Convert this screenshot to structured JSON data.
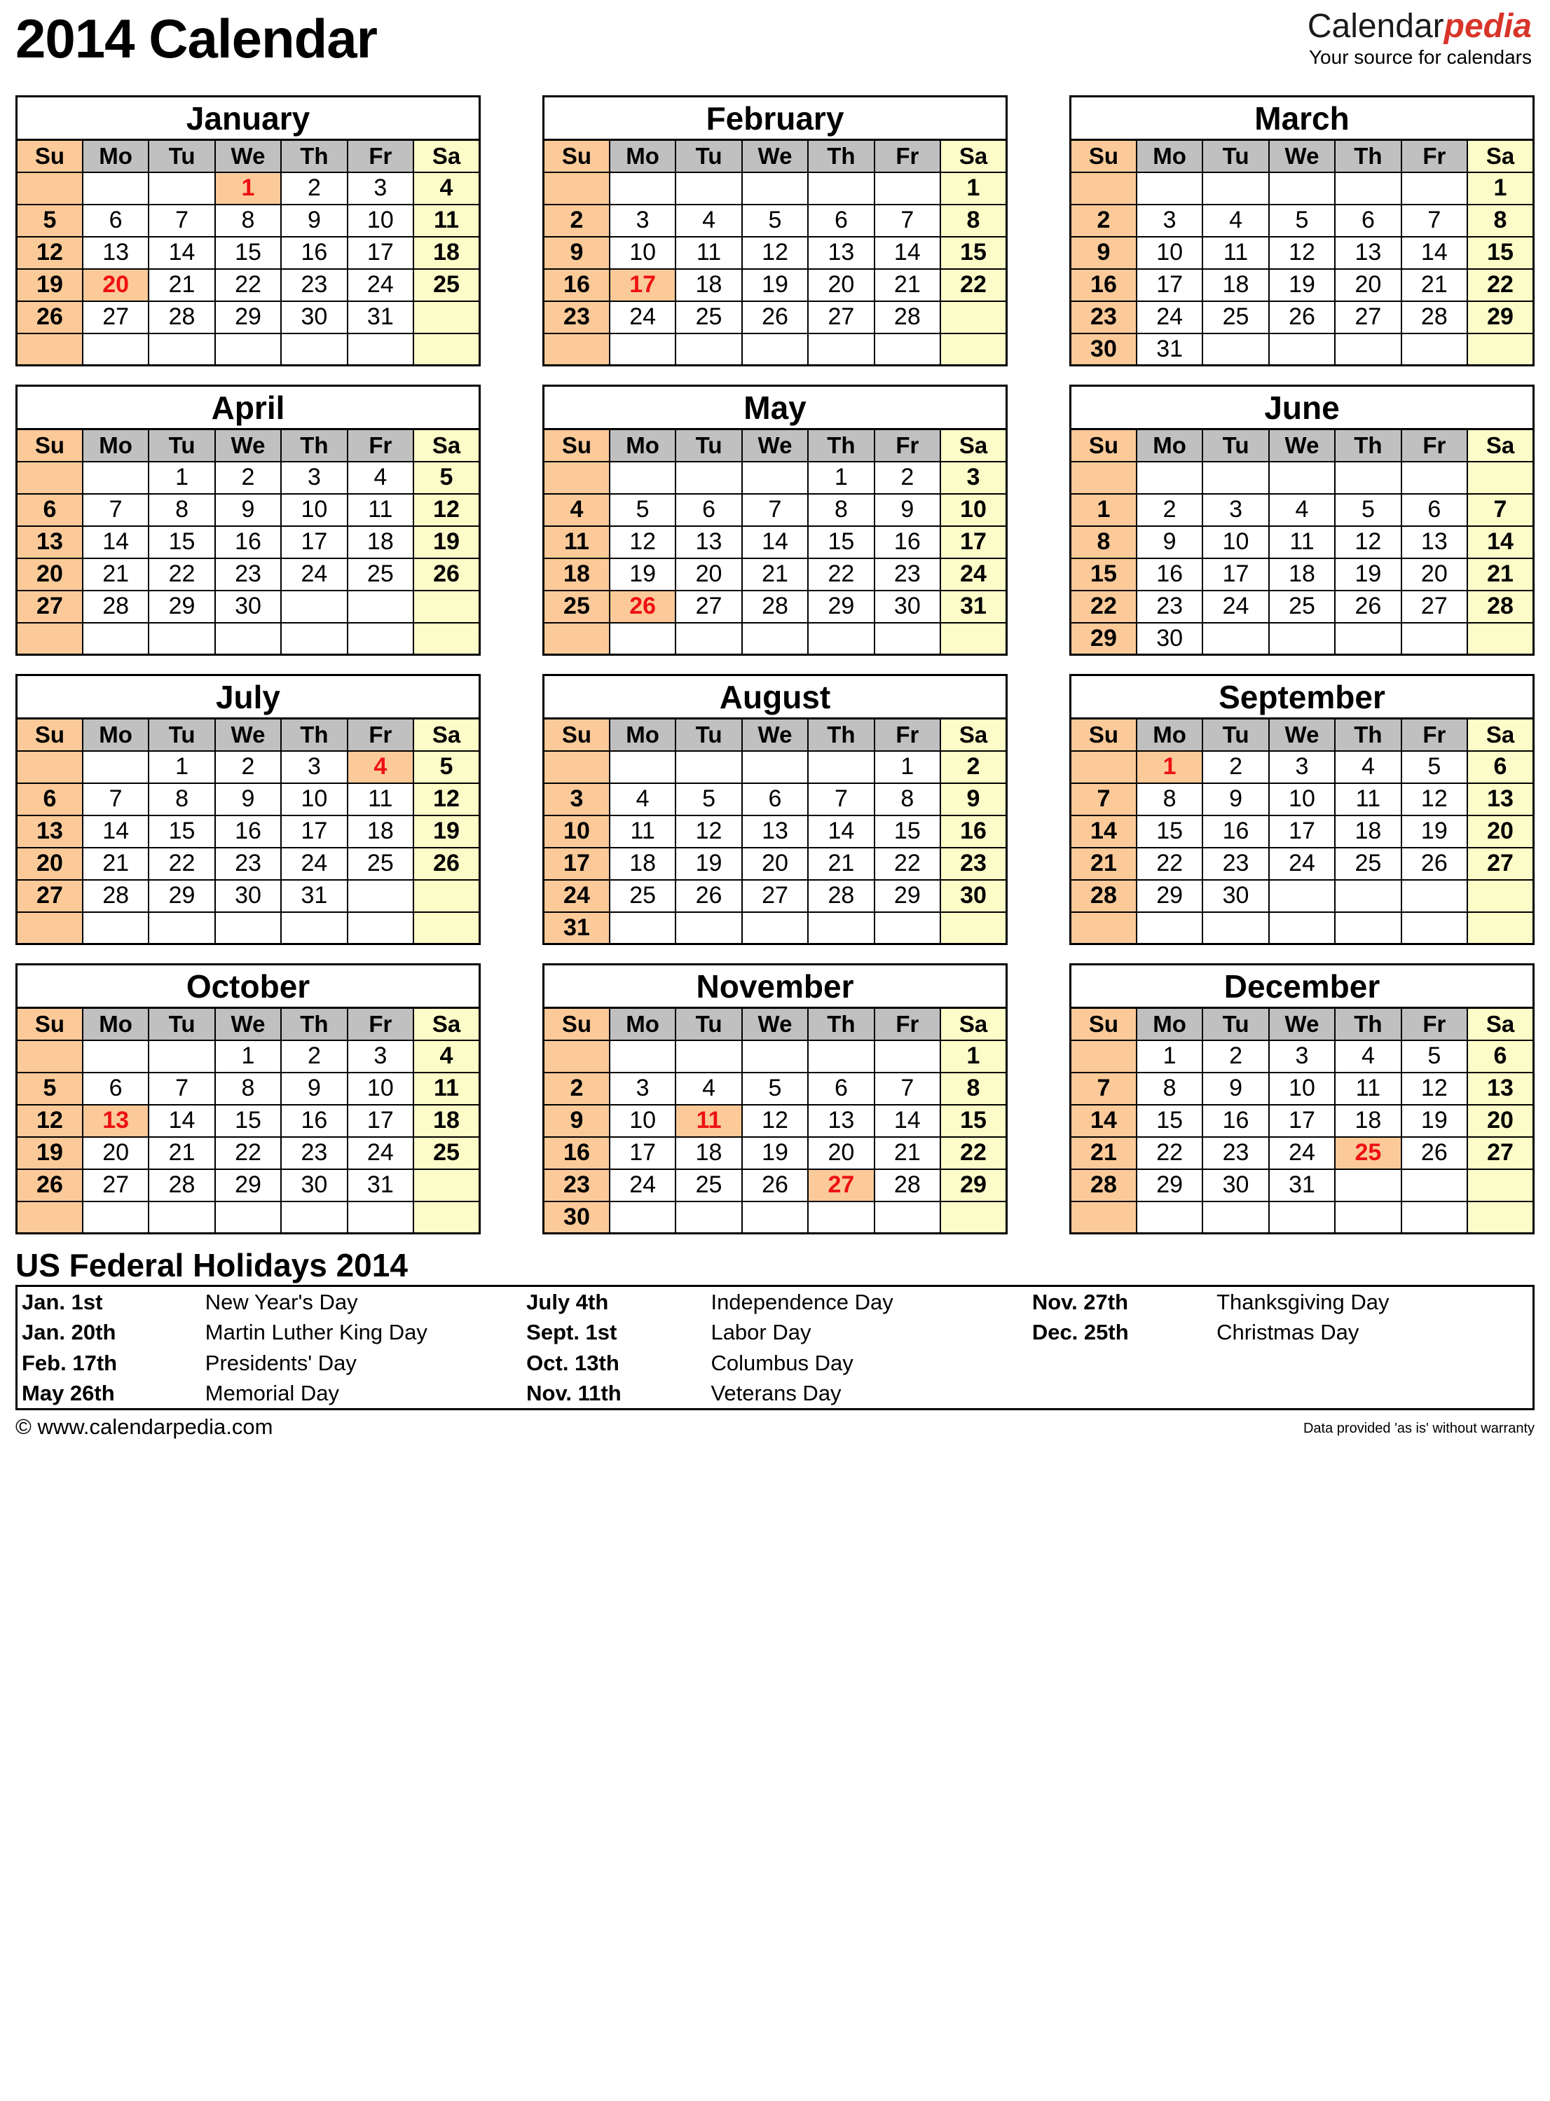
{
  "header": {
    "title": "2014 Calendar",
    "brand_black": "Calendar",
    "brand_red": "pedia",
    "tagline": "Your source for calendars"
  },
  "colors": {
    "sunday_bg": "#fcca99",
    "saturday_bg": "#fcfcc8",
    "weekday_header_bg": "#c0c0c0",
    "holiday_text": "#ee1111",
    "brand_red": "#d8352a",
    "border": "#000000"
  },
  "weekday_headers": [
    "Su",
    "Mo",
    "Tu",
    "We",
    "Th",
    "Fr",
    "Sa"
  ],
  "year": 2014,
  "months": [
    {
      "name": "January",
      "first_weekday": 3,
      "days": 31,
      "holidays": [
        1,
        20
      ]
    },
    {
      "name": "February",
      "first_weekday": 6,
      "days": 28,
      "holidays": [
        17
      ]
    },
    {
      "name": "March",
      "first_weekday": 6,
      "days": 31,
      "holidays": []
    },
    {
      "name": "April",
      "first_weekday": 2,
      "days": 30,
      "holidays": []
    },
    {
      "name": "May",
      "first_weekday": 4,
      "days": 31,
      "holidays": [
        26
      ]
    },
    {
      "name": "June",
      "first_weekday": 0,
      "days": 30,
      "holidays": [],
      "leading_blank_week": true
    },
    {
      "name": "July",
      "first_weekday": 2,
      "days": 31,
      "holidays": [
        4
      ]
    },
    {
      "name": "August",
      "first_weekday": 5,
      "days": 31,
      "holidays": []
    },
    {
      "name": "September",
      "first_weekday": 1,
      "days": 30,
      "holidays": [
        1
      ]
    },
    {
      "name": "October",
      "first_weekday": 3,
      "days": 31,
      "holidays": [
        13
      ]
    },
    {
      "name": "November",
      "first_weekday": 6,
      "days": 30,
      "holidays": [
        11,
        27
      ]
    },
    {
      "name": "December",
      "first_weekday": 1,
      "days": 31,
      "holidays": [
        25
      ]
    }
  ],
  "holidays_section": {
    "title": "US Federal Holidays 2014",
    "rows": [
      {
        "left_date": "Jan. 1st",
        "left_name": "New Year's Day",
        "mid_date": "July 4th",
        "mid_name": "Independence Day",
        "right_date": "Nov. 27th",
        "right_name": "Thanksgiving Day"
      },
      {
        "left_date": "Jan. 20th",
        "left_name": "Martin Luther King Day",
        "mid_date": "Sept. 1st",
        "mid_name": "Labor Day",
        "right_date": "Dec. 25th",
        "right_name": "Christmas Day"
      },
      {
        "left_date": "Feb. 17th",
        "left_name": "Presidents' Day",
        "mid_date": "Oct. 13th",
        "mid_name": "Columbus Day",
        "right_date": "",
        "right_name": ""
      },
      {
        "left_date": "May 26th",
        "left_name": "Memorial Day",
        "mid_date": "Nov. 11th",
        "mid_name": "Veterans Day",
        "right_date": "",
        "right_name": ""
      }
    ]
  },
  "footer": {
    "copyright": "© www.calendarpedia.com",
    "disclaimer": "Data provided 'as is' without warranty"
  }
}
